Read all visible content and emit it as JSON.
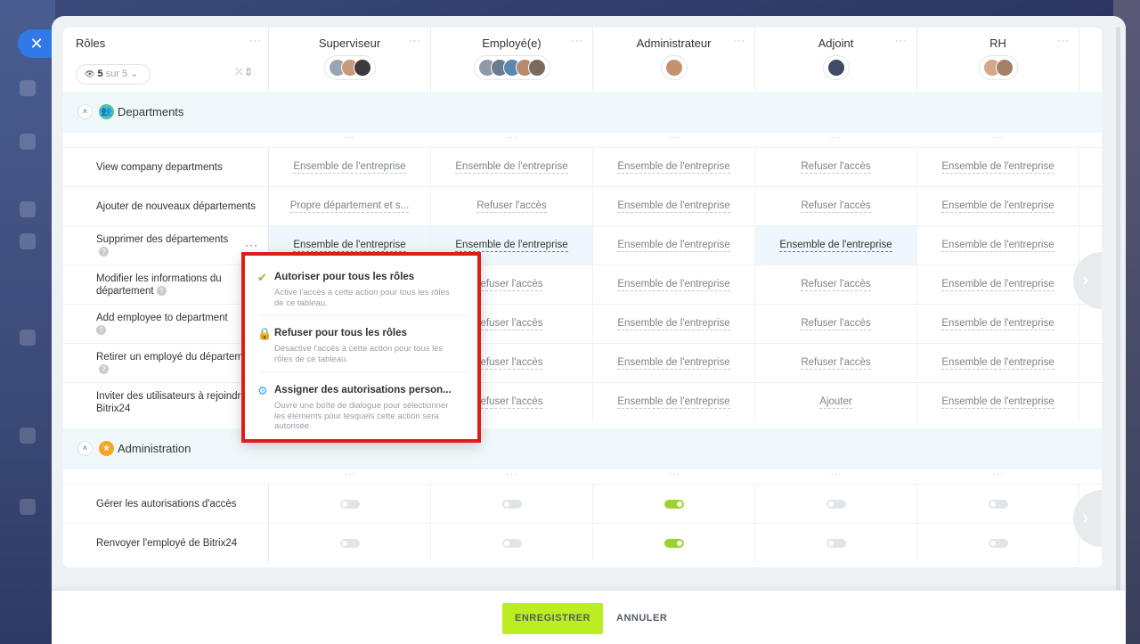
{
  "window": {
    "close_icon": "close-icon"
  },
  "header": {
    "roles_title": "Rôles",
    "dots": "···",
    "filter": {
      "count": "5",
      "suffix": "sur 5"
    },
    "columns": [
      {
        "name": "Superviseur"
      },
      {
        "name": "Employé(e)"
      },
      {
        "name": "Administrateur"
      },
      {
        "name": "Adjoint"
      },
      {
        "name": "RH"
      }
    ]
  },
  "sections": [
    {
      "title": "Departments",
      "color": "#4fc3a1",
      "rows": [
        {
          "label": "View company departments",
          "help": false,
          "cells": [
            "Ensemble de l'entreprise",
            "Ensemble de l'entreprise",
            "Ensemble de l'entreprise",
            "Refuser l'accès",
            "Ensemble de l'entreprise"
          ]
        },
        {
          "label": "Ajouter de nouveaux départements",
          "help": false,
          "cells": [
            "Propre département et s...",
            "Refuser l'accès",
            "Ensemble de l'entreprise",
            "Refuser l'accès",
            "Ensemble de l'entreprise"
          ]
        },
        {
          "label": "Supprimer des départements",
          "help": true,
          "cells": [
            "Ensemble de l'entreprise",
            "Ensemble de l'entreprise",
            "Ensemble de l'entreprise",
            "Ensemble de l'entreprise",
            "Ensemble de l'entreprise"
          ]
        },
        {
          "label": "Modifier les informations du département",
          "help": true,
          "cells": [
            "",
            "efuser l'accès",
            "Ensemble de l'entreprise",
            "Refuser l'accès",
            "Ensemble de l'entreprise"
          ]
        },
        {
          "label": "Add employee to department",
          "help": true,
          "cells": [
            "",
            "efuser l'accès",
            "Ensemble de l'entreprise",
            "Refuser l'accès",
            "Ensemble de l'entreprise"
          ]
        },
        {
          "label": "Retirer un employé du département",
          "help": true,
          "cells": [
            "",
            "efuser l'accès",
            "Ensemble de l'entreprise",
            "Refuser l'accès",
            "Ensemble de l'entreprise"
          ]
        },
        {
          "label": "Inviter des utilisateurs à rejoindre Bitrix24",
          "help": false,
          "cells": [
            "",
            "efuser l'accès",
            "Ensemble de l'entreprise",
            "Ajouter",
            "Ensemble de l'entreprise"
          ]
        }
      ]
    },
    {
      "title": "Administration",
      "color": "#f6a623",
      "rows": [
        {
          "label": "Gérer les autorisations d'accès",
          "toggles": [
            false,
            false,
            true,
            false,
            false
          ]
        },
        {
          "label": "Renvoyer l'employé de Bitrix24",
          "toggles": [
            false,
            false,
            true,
            false,
            false
          ]
        }
      ]
    }
  ],
  "popup": {
    "items": [
      {
        "title": "Autoriser pour tous les rôles",
        "desc": "Active l'accès à cette action pour tous les rôles de ce tableau.",
        "icon": "check-icon"
      },
      {
        "title": "Refuser pour tous les rôles",
        "desc": "Désactive l'accès à cette action pour tous les rôles de ce tableau.",
        "icon": "lock-icon"
      },
      {
        "title": "Assigner des autorisations person...",
        "desc": "Ouvre une boîte de dialogue pour sélectionner les éléments pour lesquels cette action sera autorisée.",
        "icon": "gear-icon"
      }
    ]
  },
  "footer": {
    "save_label": "ENREGISTRER",
    "cancel_label": "ANNULER"
  }
}
